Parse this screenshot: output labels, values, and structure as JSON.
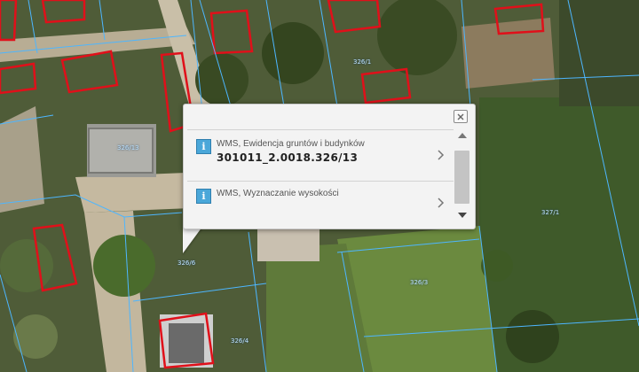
{
  "popup": {
    "close_icon": "close-x-icon",
    "items": [
      {
        "icon": "info-icon",
        "glyph": "i",
        "title": "WMS, Ewidencja gruntów i budynków",
        "value": "301011_2.0018.326/13"
      },
      {
        "icon": "info-icon",
        "glyph": "i",
        "title": "WMS, Wyznaczanie wysokości"
      }
    ]
  },
  "map": {
    "plot_labels": [
      "326/1",
      "326/13",
      "326/6",
      "326/3",
      "327/1",
      "326/4"
    ],
    "colors": {
      "building_outline": "#e0101a",
      "parcel_line": "#4db6ff",
      "vegetation": "#4d5a36"
    }
  }
}
